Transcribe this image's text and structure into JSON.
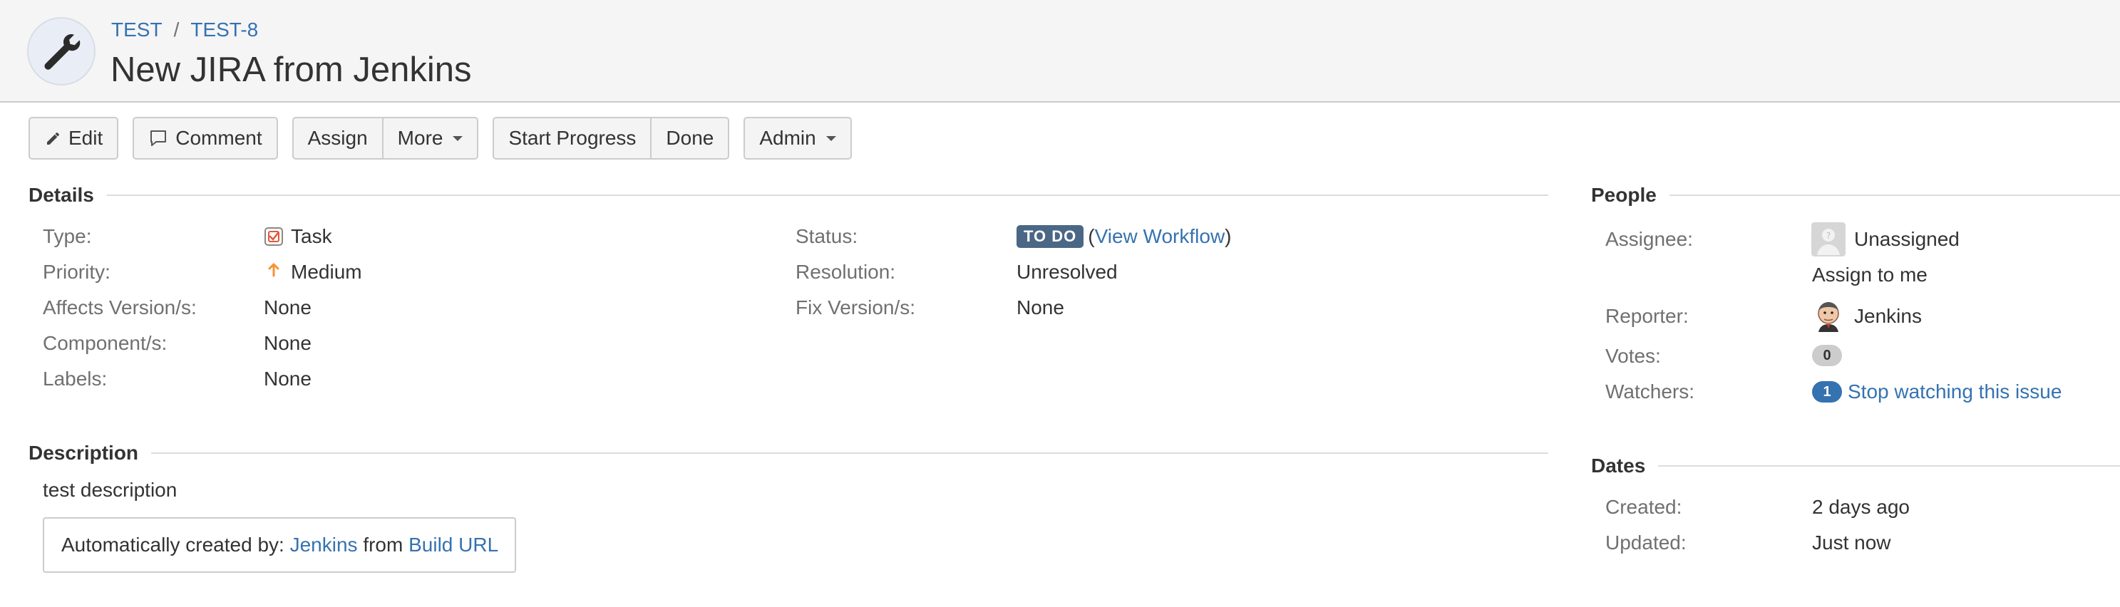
{
  "breadcrumb": {
    "project": "TEST",
    "separator": "/",
    "issue_key": "TEST-8"
  },
  "issue": {
    "summary": "New JIRA from Jenkins"
  },
  "project_icon": "wrench-icon",
  "toolbar": {
    "edit": "Edit",
    "comment": "Comment",
    "assign": "Assign",
    "more": "More",
    "start_progress": "Start Progress",
    "done": "Done",
    "admin": "Admin"
  },
  "details": {
    "heading": "Details",
    "type_label": "Type:",
    "type_value": "Task",
    "priority_label": "Priority:",
    "priority_value": "Medium",
    "affects_label": "Affects Version/s:",
    "affects_value": "None",
    "components_label": "Component/s:",
    "components_value": "None",
    "labels_label": "Labels:",
    "labels_value": "None",
    "status_label": "Status:",
    "status_value": "TO DO",
    "view_workflow": "View Workflow",
    "open_paren": "(",
    "close_paren": ")",
    "resolution_label": "Resolution:",
    "resolution_value": "Unresolved",
    "fix_label": "Fix Version/s:",
    "fix_value": "None"
  },
  "description": {
    "heading": "Description",
    "text": "test description",
    "box_prefix": "Automatically created by:",
    "box_link1": "Jenkins",
    "box_middle": "from",
    "box_link2": "Build URL"
  },
  "people": {
    "heading": "People",
    "assignee_label": "Assignee:",
    "assignee_value": "Unassigned",
    "assign_to_me": "Assign to me",
    "reporter_label": "Reporter:",
    "reporter_value": "Jenkins",
    "votes_label": "Votes:",
    "votes_value": "0",
    "watchers_label": "Watchers:",
    "watchers_count": "1",
    "watchers_action": "Stop watching this issue"
  },
  "dates": {
    "heading": "Dates",
    "created_label": "Created:",
    "created_value": "2 days ago",
    "updated_label": "Updated:",
    "updated_value": "Just now"
  },
  "colors": {
    "link": "#3572b0",
    "status_lozenge": "#4a6785",
    "priority_medium": "#f79232"
  }
}
